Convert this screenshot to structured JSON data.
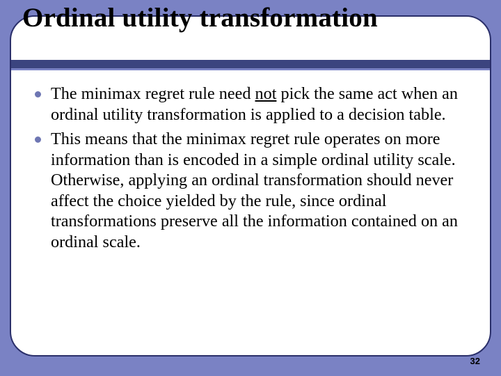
{
  "slide": {
    "title": "Ordinal utility transformation",
    "bullets": [
      {
        "pre": "The minimax regret rule need ",
        "u": "not",
        "post": " pick the same act when an ordinal utility transformation is applied to a decision table."
      },
      {
        "pre": "This means that the minimax regret rule operates on more information than is encoded in a simple ordinal utility scale. Otherwise, applying an ordinal transformation should never affect the choice yielded by the rule, since ordinal transformations preserve all the information contained on an ordinal scale.",
        "u": "",
        "post": ""
      }
    ],
    "page_number": "32"
  }
}
